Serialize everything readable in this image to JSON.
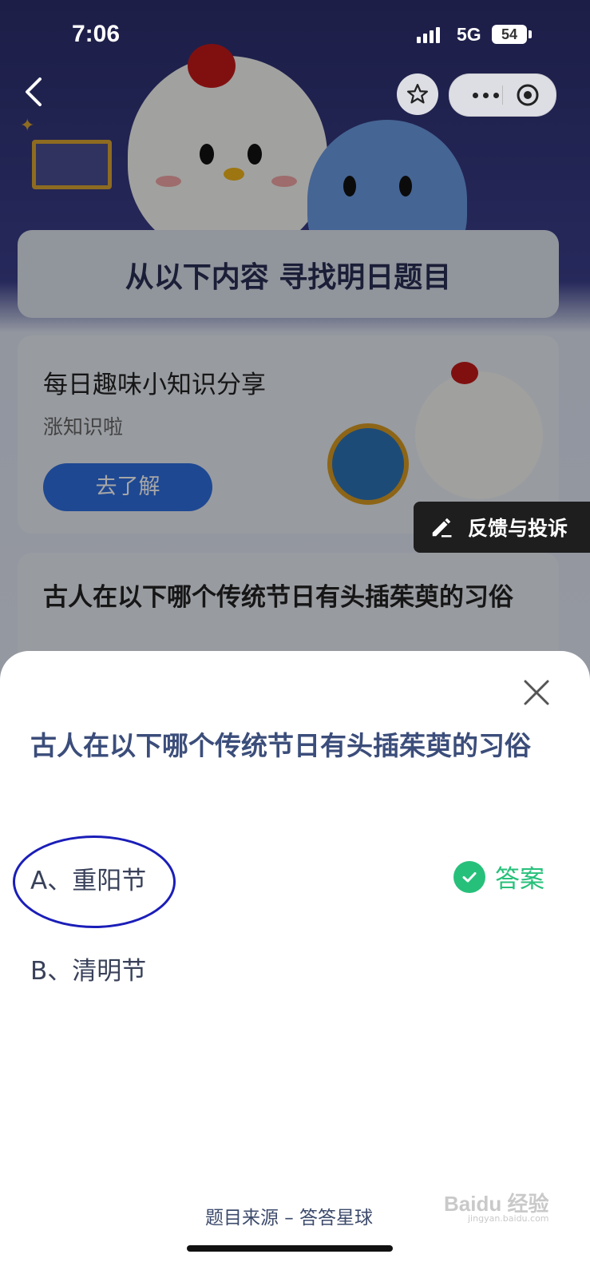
{
  "status_bar": {
    "time": "7:06",
    "network": "5G",
    "battery": "54"
  },
  "page_header": {
    "title": "从以下内容 寻找明日题目"
  },
  "card_fun_fact": {
    "title": "每日趣味小知识分享",
    "subtitle": "涨知识啦",
    "button_label": "去了解"
  },
  "card_question": {
    "title": "古人在以下哪个传统节日有头插茱萸的习俗"
  },
  "feedback": {
    "label": "反馈与投诉"
  },
  "sheet": {
    "question": "古人在以下哪个传统节日有头插茱萸的习俗",
    "options": [
      {
        "label": "A、重阳节"
      },
      {
        "label": "B、清明节"
      }
    ],
    "answer_label": "答案",
    "source": "题目来源 – 答答星球"
  },
  "watermark": {
    "text": "Baidu 经验",
    "sub": "jingyan.baidu.com"
  },
  "colors": {
    "accent_green": "#27c07a",
    "question_blue": "#3b4d7a",
    "circle_mark": "#1b1eb8",
    "button_blue": "#2f6fe0"
  }
}
